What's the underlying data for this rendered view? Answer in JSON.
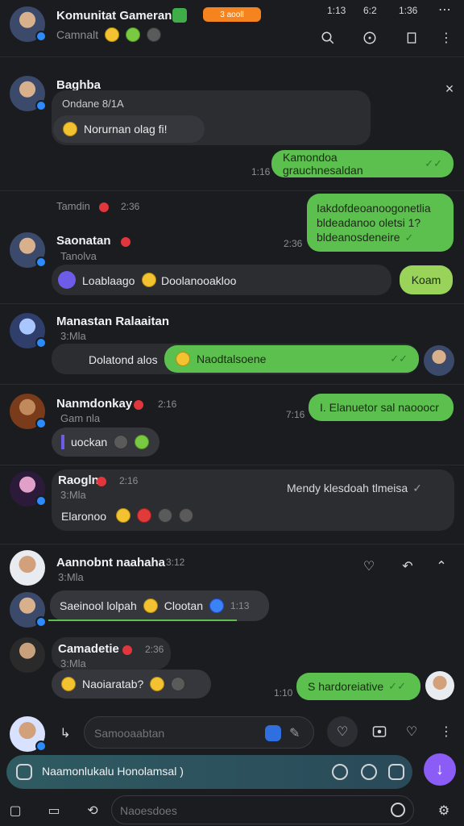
{
  "header": {
    "title": "Komunitat Gameran",
    "subtitle": "Camnalt",
    "badge_text": "3 aooll",
    "status": [
      "1:13",
      "6:2",
      "1:36"
    ]
  },
  "messages": [
    {
      "name": "Baghba",
      "sub": "Ondane 8/1A",
      "chip": "Norurnan olag fi!"
    },
    {
      "green": "Kamondoa grauchnesaldan",
      "time": "1:16"
    },
    {
      "meta": "Tamdin",
      "meta_time": "2:36"
    },
    {
      "green_multi": [
        "Iakdofdeoanoogonetlia",
        "bldeadanoo oletsi 1?",
        "bldeanosdeneire"
      ],
      "time": "2:36"
    },
    {
      "name": "Saonatan",
      "sub": "Tanolva",
      "chip_a": "Loablaago",
      "chip_b": "Doolanooakloo",
      "green": "Koam"
    },
    {
      "name": "Manastan Ralaaitan",
      "sub": "3:Mla",
      "left_text": "Dolatond alos",
      "green": "Naodtalsoene"
    },
    {
      "name": "Nanmdonkay",
      "time": "2:16",
      "sub": "Gam nla",
      "chip": "uockan",
      "green": "I. Elanuetor sal naooocr",
      "green_time": "7:16"
    },
    {
      "name": "Raogln",
      "time": "2:16",
      "sub": "3:Mla",
      "right_text": "Mendy klesdoah tlmeisa",
      "chip": "Elaronoo"
    },
    {
      "name": "Aannobnt naahaha",
      "time": "3:12",
      "sub": "3:Mla"
    },
    {
      "chip": "Saeinool lolpah",
      "chip2": "Clootan",
      "chip_time": "1:13"
    },
    {
      "name": "Camadetie",
      "time": "2:36",
      "sub": "3:Mla",
      "chip": "Naoiaratab?",
      "green": "S hardoreiative",
      "green_time": "1:10"
    }
  ],
  "composer": {
    "search_placeholder": "Samooaabtan",
    "input_value": "Naamonlukalu Honolamsal )",
    "footer_placeholder": "Naoesdoes"
  },
  "colors": {
    "accent": "#8b5cf6",
    "green": "#5cc04e",
    "badge": "#f5841f"
  }
}
